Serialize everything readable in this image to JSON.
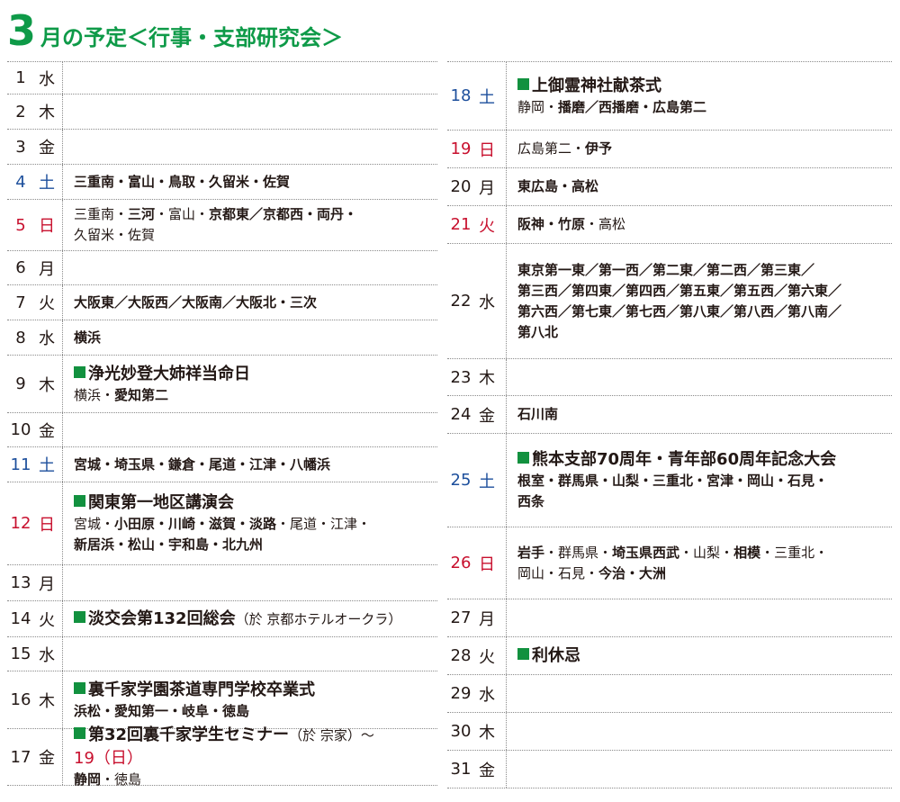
{
  "title": {
    "number": "3",
    "text": "月の予定＜行事・支部研究会＞"
  },
  "colors": {
    "accent": "#0e9a48",
    "saturday": "#1d4f9c",
    "sunday": "#c8102e"
  },
  "days": [
    {
      "d": "1",
      "w": "水",
      "c": "",
      "h": 37,
      "parts": []
    },
    {
      "d": "2",
      "w": "木",
      "c": "",
      "h": 39,
      "parts": []
    },
    {
      "d": "3",
      "w": "金",
      "c": "",
      "h": 39,
      "parts": []
    },
    {
      "d": "4",
      "w": "土",
      "c": "blue",
      "h": 39,
      "parts": [
        [
          {
            "t": "三重南・富山・鳥取・久留米・佐賀",
            "b": true
          }
        ]
      ]
    },
    {
      "d": "5",
      "w": "日",
      "c": "red",
      "h": 57,
      "parts": [
        [
          {
            "t": "三重南・",
            "b": false
          },
          {
            "t": "三河",
            "b": true
          },
          {
            "t": "・富山・",
            "b": false
          },
          {
            "t": "京都東／京都西・両丹・",
            "b": true
          }
        ],
        [
          {
            "t": "久留米・佐賀",
            "b": false
          }
        ]
      ]
    },
    {
      "d": "6",
      "w": "月",
      "c": "",
      "h": 38,
      "parts": []
    },
    {
      "d": "7",
      "w": "火",
      "c": "",
      "h": 39,
      "parts": [
        [
          {
            "t": "大阪東／大阪西／大阪南／大阪北・三次",
            "b": true
          }
        ]
      ]
    },
    {
      "d": "8",
      "w": "水",
      "c": "",
      "h": 39,
      "parts": [
        [
          {
            "t": "横浜",
            "b": true
          }
        ]
      ]
    },
    {
      "d": "9",
      "w": "木",
      "c": "",
      "h": 64,
      "event": "浄光妙登大姉祥当命日",
      "parts": [
        [
          {
            "t": "横浜・",
            "b": false
          },
          {
            "t": "愛知第二",
            "b": true
          }
        ]
      ]
    },
    {
      "d": "10",
      "w": "金",
      "c": "",
      "h": 38,
      "parts": []
    },
    {
      "d": "11",
      "w": "土",
      "c": "blue",
      "h": 39,
      "parts": [
        [
          {
            "t": "宮城・埼玉県・鎌倉・尾道・江津・八幡浜",
            "b": true
          }
        ]
      ]
    },
    {
      "d": "12",
      "w": "日",
      "c": "red",
      "h": 92,
      "event": "関東第一地区講演会",
      "parts": [
        [
          {
            "t": "宮城・",
            "b": false
          },
          {
            "t": "小田原・川崎・滋賀・淡路",
            "b": true
          },
          {
            "t": "・尾道・江津・",
            "b": false
          }
        ],
        [
          {
            "t": "新居浜・松山・宇和島・北九州",
            "b": true
          }
        ]
      ]
    },
    {
      "d": "13",
      "w": "月",
      "c": "",
      "h": 40,
      "parts": []
    },
    {
      "d": "14",
      "w": "火",
      "c": "",
      "h": 40,
      "event": "淡交会第132回総会",
      "eventParen": "（於 京都ホテルオークラ）",
      "parts": []
    },
    {
      "d": "15",
      "w": "水",
      "c": "",
      "h": 38,
      "parts": []
    },
    {
      "d": "16",
      "w": "木",
      "c": "",
      "h": 64,
      "event": "裏千家学園茶道専門学校卒業式",
      "parts": [
        [
          {
            "t": "浜松・愛知第一・岐阜・徳島",
            "b": true
          }
        ]
      ]
    },
    {
      "d": "17",
      "w": "金",
      "c": "",
      "h": 63,
      "event": "第32回裏千家学生セミナー",
      "eventParen": "（於 宗家）〜",
      "eventRed": "19（日）",
      "parts": [
        [
          {
            "t": "静岡",
            "b": true
          },
          {
            "t": "・徳島",
            "b": false
          }
        ]
      ]
    },
    {
      "d": "18",
      "w": "土",
      "c": "blue",
      "h": 77,
      "event": "上御霊神社献茶式",
      "parts": [
        [
          {
            "t": "静岡・",
            "b": false
          },
          {
            "t": "播磨／西播磨・広島第二",
            "b": true
          }
        ]
      ]
    },
    {
      "d": "19",
      "w": "日",
      "c": "red",
      "h": 42,
      "parts": [
        [
          {
            "t": "広島第二・",
            "b": false
          },
          {
            "t": "伊予",
            "b": true
          }
        ]
      ]
    },
    {
      "d": "20",
      "w": "月",
      "c": "",
      "h": 42,
      "parts": [
        [
          {
            "t": "東広島・高松",
            "b": true
          }
        ]
      ]
    },
    {
      "d": "21",
      "w": "火",
      "c": "red",
      "h": 42,
      "parts": [
        [
          {
            "t": "阪神・竹原",
            "b": true
          },
          {
            "t": "・高松",
            "b": false
          }
        ]
      ]
    },
    {
      "d": "22",
      "w": "水",
      "c": "",
      "h": 128,
      "parts": [
        [
          {
            "t": "東京第一東／第一西／第二東／第二西／第三東／",
            "b": true
          }
        ],
        [
          {
            "t": "第三西／第四東／第四西／第五東／第五西／第六東／",
            "b": true
          }
        ],
        [
          {
            "t": "第六西／第七東／第七西／第八東／第八西／第八南／",
            "b": true
          }
        ],
        [
          {
            "t": "第八北",
            "b": true
          }
        ]
      ]
    },
    {
      "d": "23",
      "w": "木",
      "c": "",
      "h": 41,
      "parts": []
    },
    {
      "d": "24",
      "w": "金",
      "c": "",
      "h": 42,
      "parts": [
        [
          {
            "t": "石川南",
            "b": true
          }
        ]
      ]
    },
    {
      "d": "25",
      "w": "土",
      "c": "blue",
      "h": 104,
      "event": "熊本支部70周年・青年部60周年記念大会",
      "parts": [
        [
          {
            "t": "根室・群馬県・山梨・三重北・宮津・岡山・石見・",
            "b": true
          }
        ],
        [
          {
            "t": "西条",
            "b": true
          }
        ]
      ]
    },
    {
      "d": "26",
      "w": "日",
      "c": "red",
      "h": 80,
      "parts": [
        [
          {
            "t": "岩手",
            "b": true
          },
          {
            "t": "・群馬県・",
            "b": false
          },
          {
            "t": "埼玉県西武",
            "b": true
          },
          {
            "t": "・山梨・",
            "b": false
          },
          {
            "t": "相模",
            "b": true
          },
          {
            "t": "・三重北・",
            "b": false
          }
        ],
        [
          {
            "t": "岡山・石見・",
            "b": false
          },
          {
            "t": "今治・大洲",
            "b": true
          }
        ]
      ]
    },
    {
      "d": "27",
      "w": "月",
      "c": "",
      "h": 42,
      "parts": []
    },
    {
      "d": "28",
      "w": "火",
      "c": "",
      "h": 42,
      "event": "利休忌",
      "parts": []
    },
    {
      "d": "29",
      "w": "水",
      "c": "",
      "h": 42,
      "parts": []
    },
    {
      "d": "30",
      "w": "木",
      "c": "",
      "h": 42,
      "parts": []
    },
    {
      "d": "31",
      "w": "金",
      "c": "",
      "h": 42,
      "parts": []
    }
  ]
}
